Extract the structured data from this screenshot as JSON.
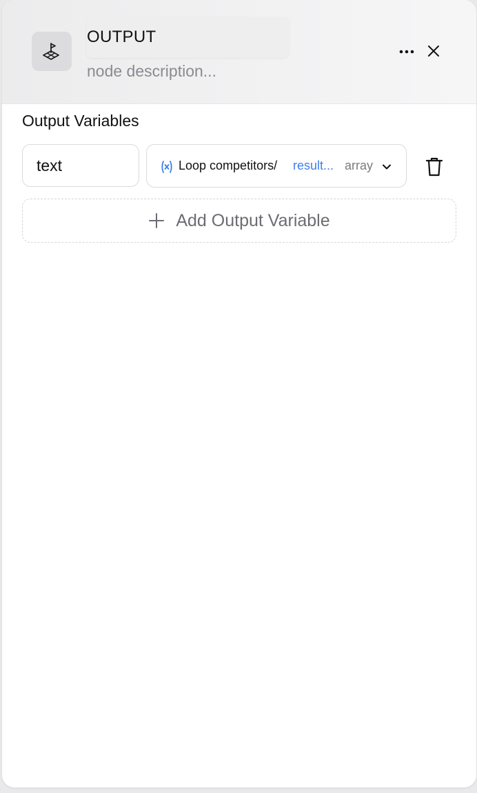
{
  "header": {
    "title": "OUTPUT",
    "description_placeholder": "node description..."
  },
  "icons": {
    "node": "flag-stand-icon",
    "more": "more-horizontal-icon",
    "close": "close-icon",
    "variable": "variable-x-icon",
    "chevron": "chevron-down-icon",
    "delete": "trash-icon",
    "add": "plus-icon"
  },
  "output_section": {
    "label": "Output Variables",
    "variables": [
      {
        "name": "text",
        "source": "Loop competitors/",
        "source_var": "result...",
        "type": "array"
      }
    ],
    "add_label": "Add Output Variable"
  },
  "colors": {
    "accent_blue": "#3e7fe8",
    "muted_text": "#8a8a90"
  }
}
